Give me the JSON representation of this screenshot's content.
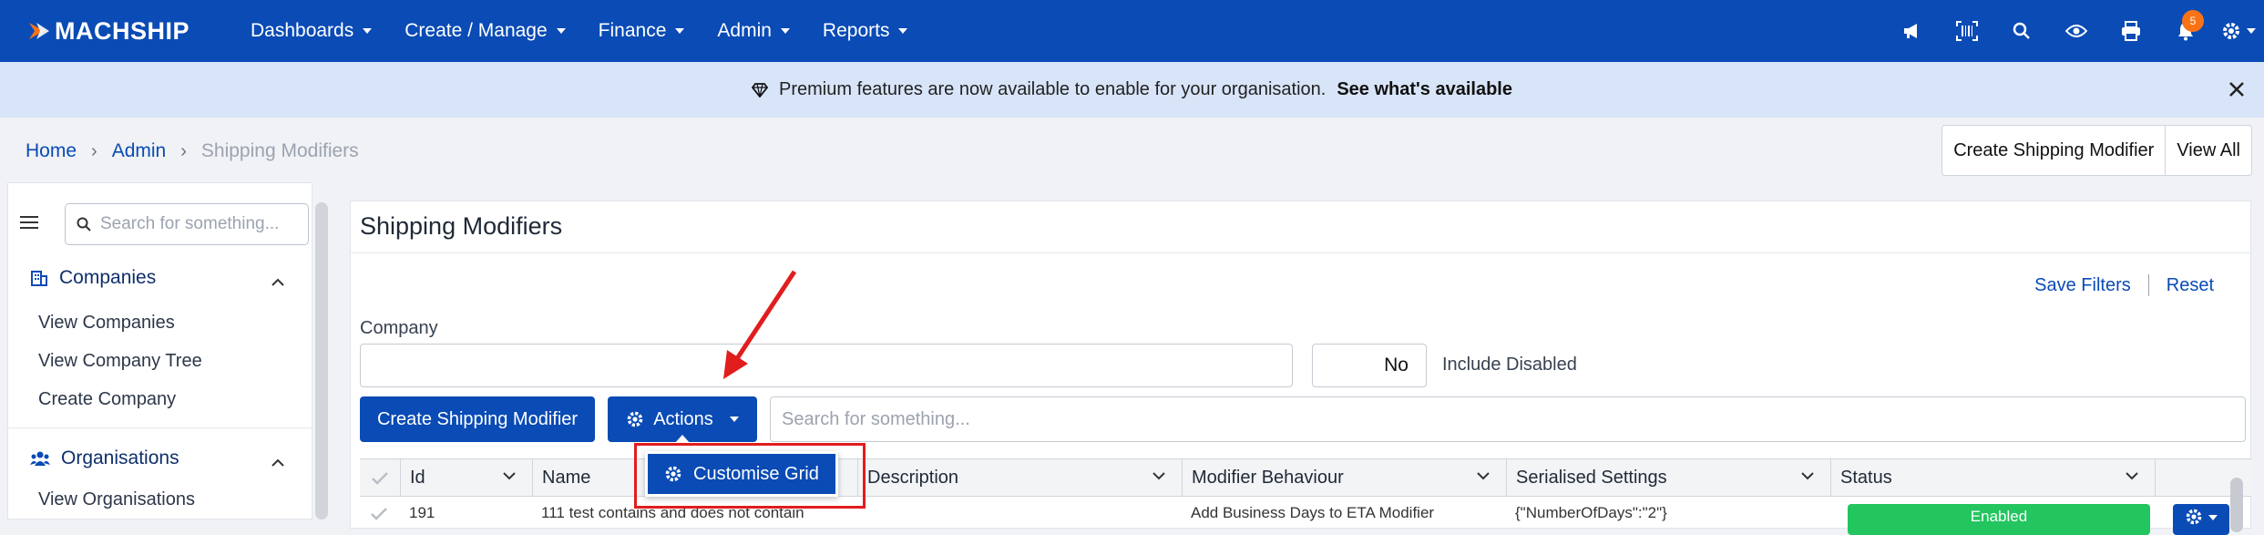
{
  "brand": {
    "name": "MACHSHIP",
    "accent": "#f97316",
    "primary": "#0a4bb5"
  },
  "nav": {
    "items": [
      {
        "label": "Dashboards"
      },
      {
        "label": "Create / Manage"
      },
      {
        "label": "Finance"
      },
      {
        "label": "Admin"
      },
      {
        "label": "Reports"
      }
    ],
    "icons": [
      "megaphone-icon",
      "barcode-scan-icon",
      "search-icon",
      "eye-icon",
      "printer-icon",
      "bell-icon",
      "gear-icon"
    ],
    "notification_count": "5"
  },
  "banner": {
    "text": "Premium features are now available to enable for your organisation.",
    "link": "See what's available"
  },
  "breadcrumb": {
    "items": [
      "Home",
      "Admin"
    ],
    "current": "Shipping Modifiers"
  },
  "header_buttons": {
    "create": "Create Shipping Modifier",
    "view_all": "View All"
  },
  "sidebar": {
    "search_placeholder": "Search for something...",
    "sections": [
      {
        "label": "Companies",
        "links": [
          "View Companies",
          "View Company Tree",
          "Create Company"
        ]
      },
      {
        "label": "Organisations",
        "links": [
          "View Organisations"
        ]
      }
    ]
  },
  "main": {
    "title": "Shipping Modifiers",
    "save_filters": "Save Filters",
    "reset": "Reset",
    "company_label": "Company",
    "company_value": "",
    "include_disabled_value": "No",
    "include_disabled_label": "Include Disabled",
    "create_button": "Create Shipping Modifier",
    "actions_button": "Actions",
    "grid_search_placeholder": "Search for something...",
    "actions_menu": {
      "items": [
        "Customise Grid"
      ]
    },
    "grid": {
      "columns": [
        "Id",
        "Name",
        "Description",
        "Modifier Behaviour",
        "Serialised Settings",
        "Status"
      ],
      "rows": [
        {
          "id": "191",
          "name": "111 test contains and does not contain",
          "description": "",
          "behaviour": "Add Business Days to ETA Modifier",
          "settings": "{\"NumberOfDays\":\"2\"}",
          "status": "Enabled"
        }
      ]
    }
  }
}
